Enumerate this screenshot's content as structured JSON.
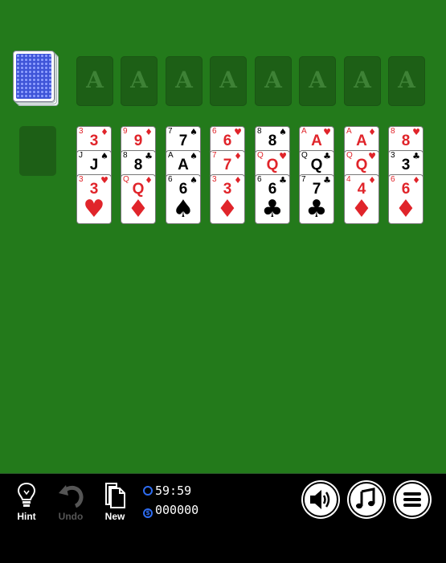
{
  "stock": {
    "icon": "card-back-pattern"
  },
  "foundations": [
    "A",
    "A",
    "A",
    "A",
    "A",
    "A",
    "A",
    "A"
  ],
  "tableau": [
    [
      {
        "rank": "3",
        "suit": "♦",
        "color": "red"
      },
      {
        "rank": "J",
        "suit": "♠",
        "color": "black"
      },
      {
        "rank": "3",
        "suit": "♥",
        "color": "red"
      }
    ],
    [
      {
        "rank": "9",
        "suit": "♦",
        "color": "red"
      },
      {
        "rank": "8",
        "suit": "♣",
        "color": "black"
      },
      {
        "rank": "Q",
        "suit": "♦",
        "color": "red"
      }
    ],
    [
      {
        "rank": "7",
        "suit": "♠",
        "color": "black"
      },
      {
        "rank": "A",
        "suit": "♠",
        "color": "black"
      },
      {
        "rank": "6",
        "suit": "♠",
        "color": "black"
      }
    ],
    [
      {
        "rank": "6",
        "suit": "♥",
        "color": "red"
      },
      {
        "rank": "7",
        "suit": "♦",
        "color": "red"
      },
      {
        "rank": "3",
        "suit": "♦",
        "color": "red"
      }
    ],
    [
      {
        "rank": "8",
        "suit": "♠",
        "color": "black"
      },
      {
        "rank": "Q",
        "suit": "♥",
        "color": "red"
      },
      {
        "rank": "6",
        "suit": "♣",
        "color": "black"
      }
    ],
    [
      {
        "rank": "A",
        "suit": "♥",
        "color": "red"
      },
      {
        "rank": "Q",
        "suit": "♣",
        "color": "black"
      },
      {
        "rank": "7",
        "suit": "♣",
        "color": "black"
      }
    ],
    [
      {
        "rank": "A",
        "suit": "♦",
        "color": "red"
      },
      {
        "rank": "Q",
        "suit": "♥",
        "color": "red"
      },
      {
        "rank": "4",
        "suit": "♦",
        "color": "red"
      }
    ],
    [
      {
        "rank": "8",
        "suit": "♥",
        "color": "red"
      },
      {
        "rank": "3",
        "suit": "♣",
        "color": "black"
      },
      {
        "rank": "6",
        "suit": "♦",
        "color": "red"
      }
    ]
  ],
  "toolbar": {
    "hint_label": "Hint",
    "undo_label": "Undo",
    "new_label": "New",
    "timer": "59:59",
    "score": "000000"
  },
  "colors": {
    "felt": "#237a1b",
    "slot": "#1d5f16",
    "red": "#e0242a",
    "accent": "#2e6cf0"
  }
}
